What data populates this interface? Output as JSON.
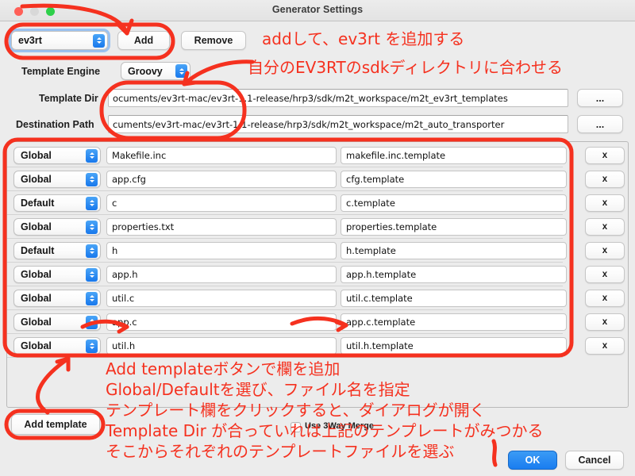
{
  "window": {
    "title": "Generator Settings",
    "traffic_lights": [
      "close-light",
      "minimize-light",
      "zoom-light"
    ]
  },
  "toolbar": {
    "preset_value": "ev3rt",
    "add_label": "Add",
    "remove_label": "Remove"
  },
  "form": {
    "engine_label": "Template Engine",
    "engine_value": "Groovy",
    "template_dir_label": "Template Dir",
    "template_dir_value": "ocuments/ev3rt-mac/ev3rt-1.1-release/hrp3/sdk/m2t_workspace/m2t_ev3rt_templates",
    "destination_label": "Destination Path",
    "destination_value": "cuments/ev3rt-mac/ev3rt-1.1-release/hrp3/sdk/m2t_workspace/m2t_auto_transporter",
    "browse_label": "..."
  },
  "table": {
    "delete_label": "x",
    "scope_options": [
      "Global",
      "Default"
    ],
    "rows": [
      {
        "scope": "Global",
        "file": "Makefile.inc",
        "template": "makefile.inc.template"
      },
      {
        "scope": "Global",
        "file": "app.cfg",
        "template": "cfg.template"
      },
      {
        "scope": "Default",
        "file": "c",
        "template": "c.template"
      },
      {
        "scope": "Global",
        "file": "properties.txt",
        "template": "properties.template"
      },
      {
        "scope": "Default",
        "file": "h",
        "template": "h.template"
      },
      {
        "scope": "Global",
        "file": "app.h",
        "template": "app.h.template"
      },
      {
        "scope": "Global",
        "file": "util.c",
        "template": "util.c.template"
      },
      {
        "scope": "Global",
        "file": "app.c",
        "template": "app.c.template"
      },
      {
        "scope": "Global",
        "file": "util.h",
        "template": "util.h.template"
      }
    ]
  },
  "footer": {
    "add_template_label": "Add template",
    "merge_label": "Use 3Way Merge",
    "merge_checked": false,
    "ok_label": "OK",
    "cancel_label": "Cancel"
  },
  "annotations": {
    "color": "#f5311f",
    "add_note": "addして、ev3rt を追加する",
    "sdk_note": "自分のEV3RTのsdkディレクトリに合わせる",
    "block_line1": "Add templateボタンで欄を追加",
    "block_line2": "Global/Defaultを選び、ファイル名を指定",
    "block_line3": "テンプレート欄をクリックすると、ダイアログが開く",
    "block_line4": "Template Dir が合っていれは上記のテンプレートがみつかる",
    "block_line5": "そこからそれぞれのテンプレートファイルを選ぶ"
  }
}
